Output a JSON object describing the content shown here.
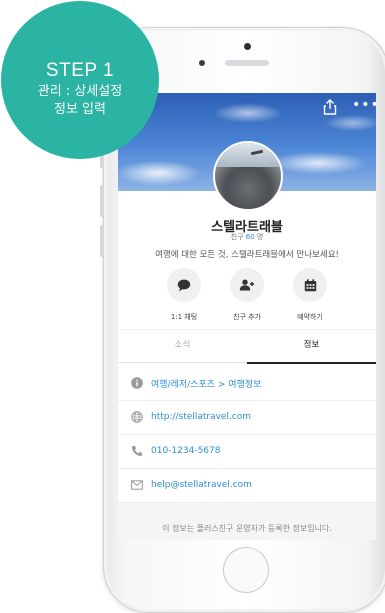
{
  "badge": {
    "step": "STEP 1",
    "line1": "관리 : 상세설정",
    "line2": "정보 입력"
  },
  "profile": {
    "name": "스텔라트래블",
    "friends_label": "친구",
    "friends_count": "60",
    "friends_unit": "명",
    "description": "여행에 대한 모든 것, 스텔라트래블에서 만나보세요!"
  },
  "actions": [
    {
      "label": "1:1 채팅",
      "icon": "chat-bubble-icon"
    },
    {
      "label": "친구 추가",
      "icon": "add-friend-icon"
    },
    {
      "label": "예약하기",
      "icon": "calendar-icon"
    }
  ],
  "tabs": [
    {
      "label": "소식"
    },
    {
      "label": "정보"
    }
  ],
  "info": {
    "category": "여행/레저/스포츠 > 여행정보",
    "website": "http://stellatravel.com",
    "phone": "010-1234-5678",
    "email": "help@stellatravel.com"
  },
  "footer_note": "이 정보는 플러스친구 운영자가 등록한 정보입니다.",
  "colors": {
    "badge": "#2bb3a3",
    "link": "#2b8fd6"
  }
}
